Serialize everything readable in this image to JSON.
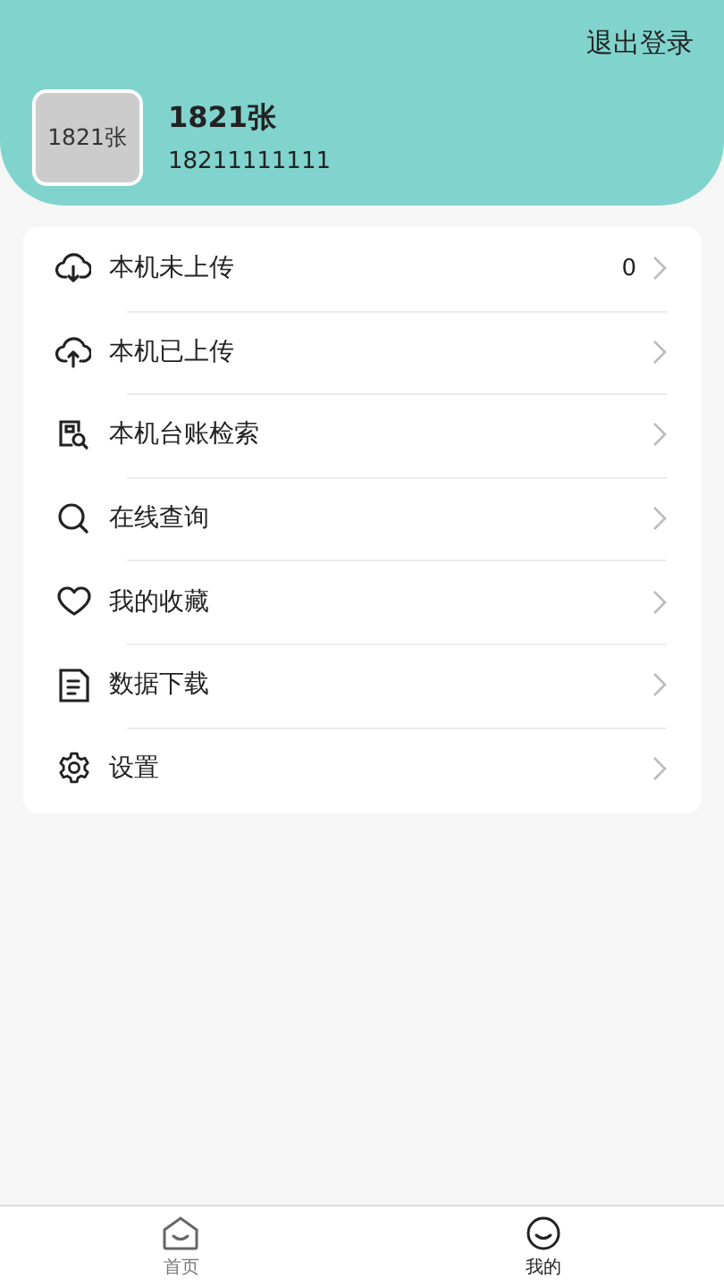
{
  "header": {
    "logout": "退出登录",
    "avatar_label": "1821张",
    "name": "1821张",
    "phone": "18211111111"
  },
  "menu": [
    {
      "label": "本机未上传",
      "count": "0"
    },
    {
      "label": "本机已上传"
    },
    {
      "label": "本机台账检索"
    },
    {
      "label": "在线查询"
    },
    {
      "label": "我的收藏"
    },
    {
      "label": "数据下载"
    },
    {
      "label": "设置"
    }
  ],
  "tabs": [
    {
      "label": "首页",
      "selected": false
    },
    {
      "label": "我的",
      "selected": true
    }
  ]
}
